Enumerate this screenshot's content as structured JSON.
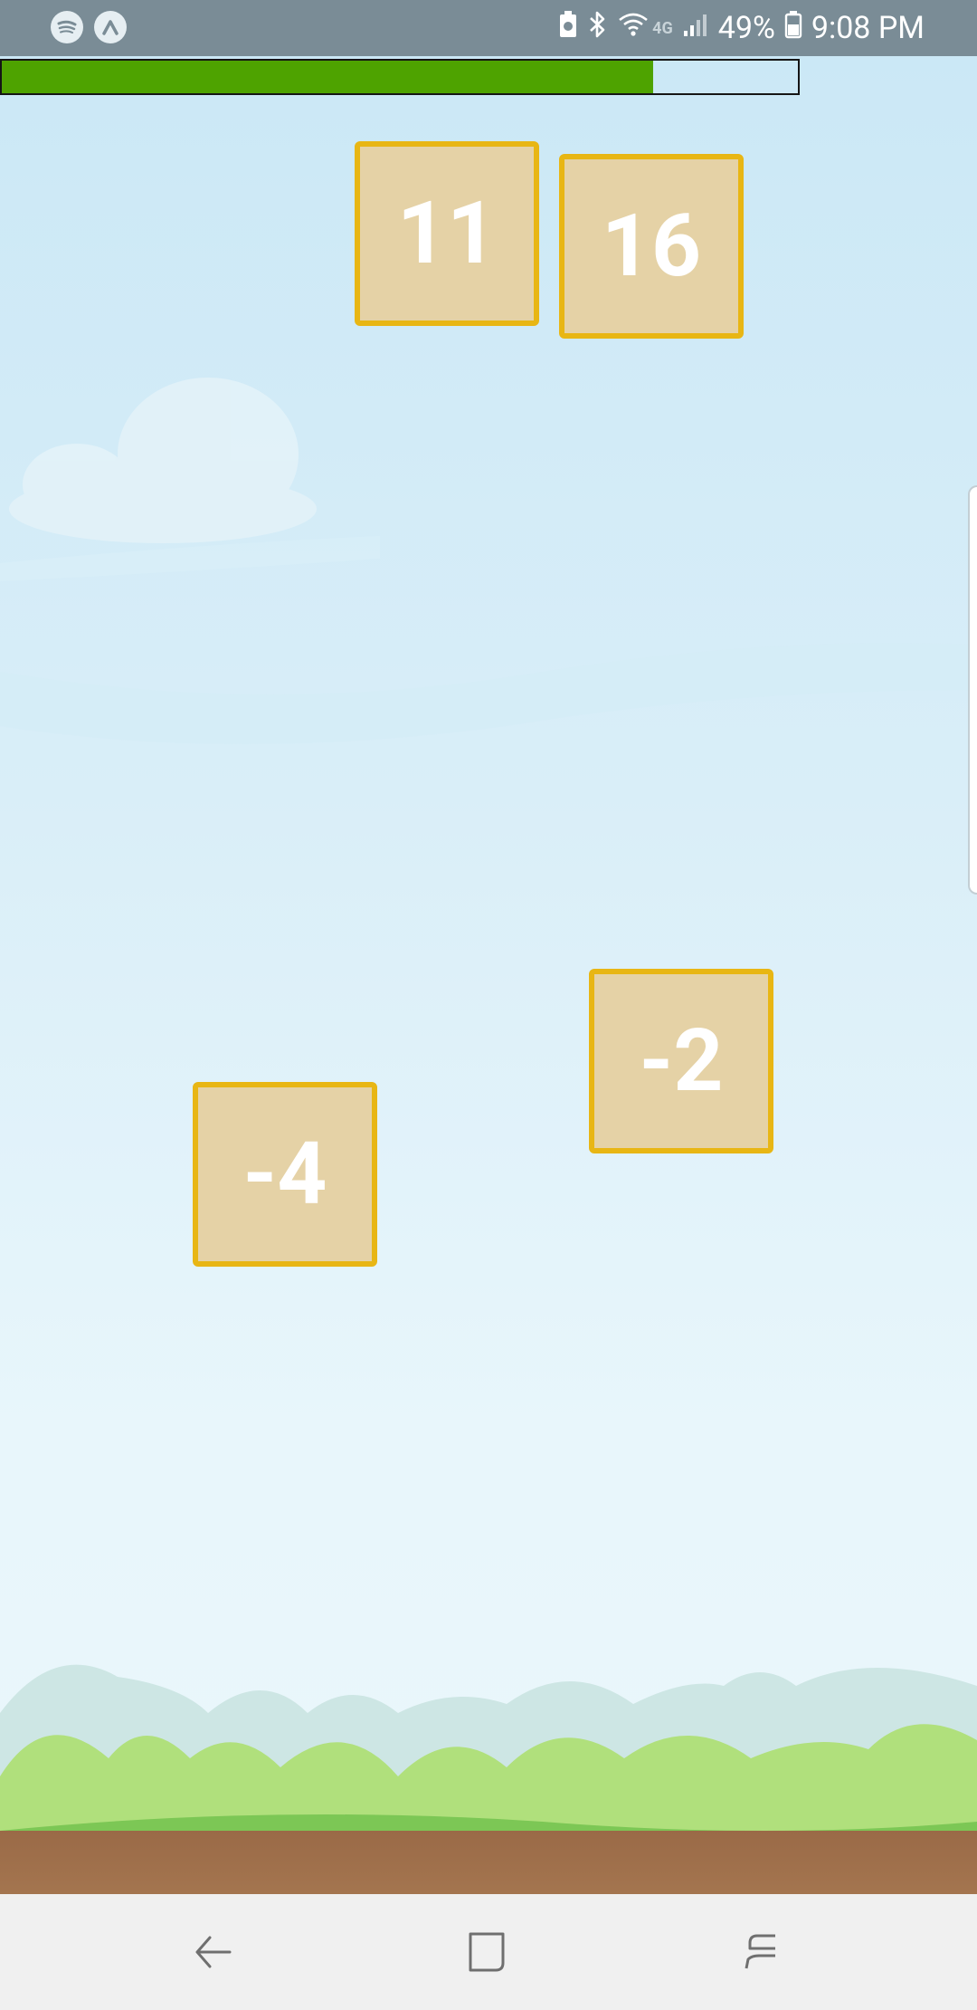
{
  "status_bar": {
    "battery_percent": "49%",
    "time": "9:08 PM",
    "network_label": "4G",
    "icons": [
      "spotify-icon",
      "app-drawer-icon",
      "battery-saver-icon",
      "bluetooth-icon",
      "wifi-icon",
      "signal-icon",
      "battery-icon"
    ]
  },
  "game": {
    "progress_fraction": 0.818,
    "progress_color": "#4ea300",
    "tiles": [
      {
        "value": "11"
      },
      {
        "value": "16"
      },
      {
        "value": "-2"
      },
      {
        "value": "-4"
      }
    ],
    "tile_border_color": "#e8b614",
    "tile_fill_color": "#e5d2a6"
  },
  "nav_bar": {
    "icons": [
      "back-icon",
      "home-icon",
      "recents-icon"
    ]
  }
}
